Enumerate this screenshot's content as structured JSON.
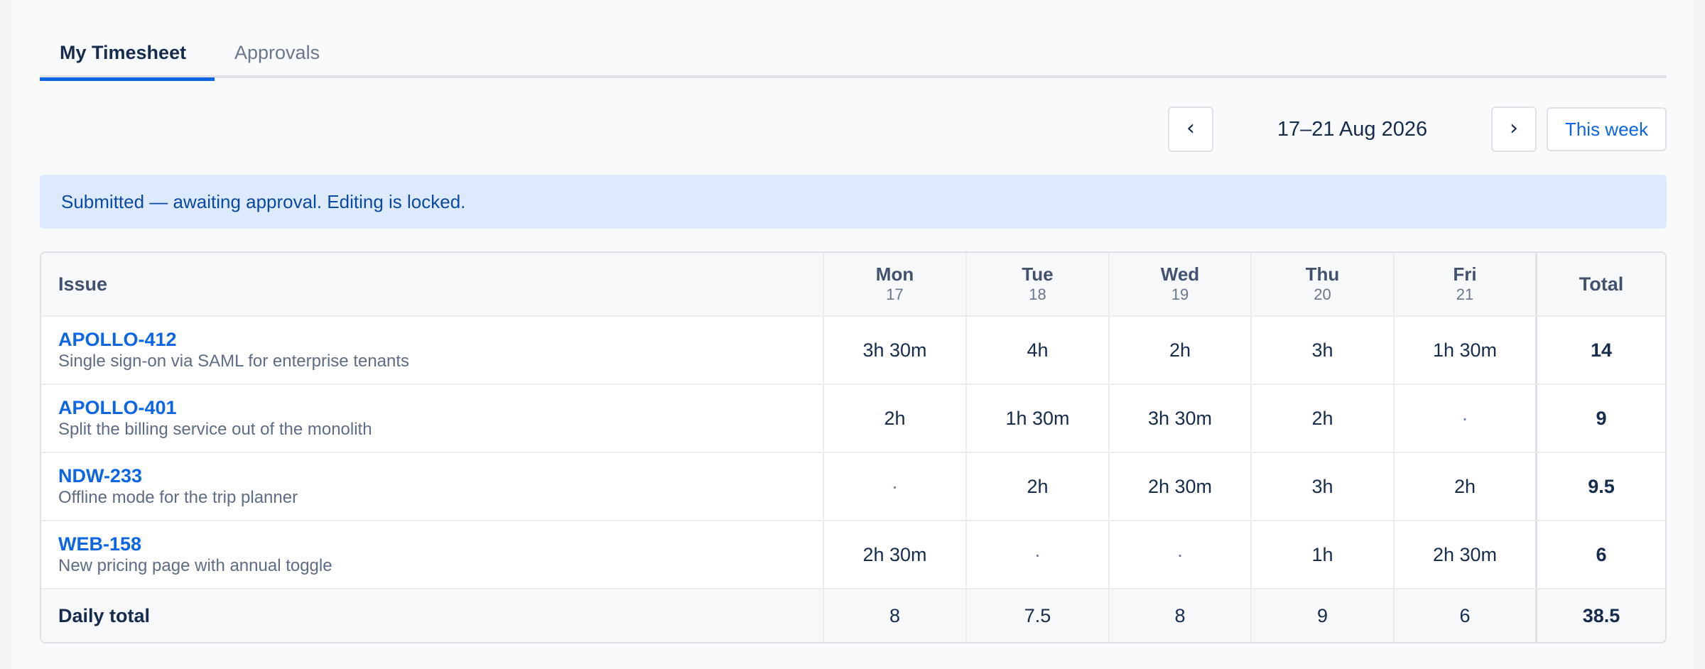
{
  "tabs": [
    {
      "label": "My Timesheet",
      "active": true
    },
    {
      "label": "Approvals",
      "active": false
    }
  ],
  "week_nav": {
    "prev_icon": "‹",
    "next_icon": "›",
    "range": "17–21 Aug 2026",
    "this_week_label": "This week"
  },
  "banner": {
    "text": "Submitted — awaiting approval. Editing is locked."
  },
  "table": {
    "issue_header": "Issue",
    "total_header": "Total",
    "days": [
      {
        "name": "Mon",
        "date": "17"
      },
      {
        "name": "Tue",
        "date": "18"
      },
      {
        "name": "Wed",
        "date": "19"
      },
      {
        "name": "Thu",
        "date": "20"
      },
      {
        "name": "Fri",
        "date": "21"
      }
    ],
    "rows": [
      {
        "key": "APOLLO-412",
        "title": "Single sign-on via SAML for enterprise tenants",
        "hours": [
          "3h 30m",
          "4h",
          "2h",
          "3h",
          "1h 30m"
        ],
        "total": "14"
      },
      {
        "key": "APOLLO-401",
        "title": "Split the billing service out of the monolith",
        "hours": [
          "2h",
          "1h 30m",
          "3h 30m",
          "2h",
          "·"
        ],
        "total": "9"
      },
      {
        "key": "NDW-233",
        "title": "Offline mode for the trip planner",
        "hours": [
          "·",
          "2h",
          "2h 30m",
          "3h",
          "2h"
        ],
        "total": "9.5"
      },
      {
        "key": "WEB-158",
        "title": "New pricing page with annual toggle",
        "hours": [
          "2h 30m",
          "·",
          "·",
          "1h",
          "2h 30m"
        ],
        "total": "6"
      }
    ],
    "footer": {
      "label": "Daily total",
      "values": [
        "8",
        "7.5",
        "8",
        "9",
        "6"
      ],
      "total": "38.5"
    }
  },
  "colors": {
    "accent": "#0c66e4",
    "banner_bg": "#dde9fd",
    "banner_text": "#0b4aa2"
  }
}
